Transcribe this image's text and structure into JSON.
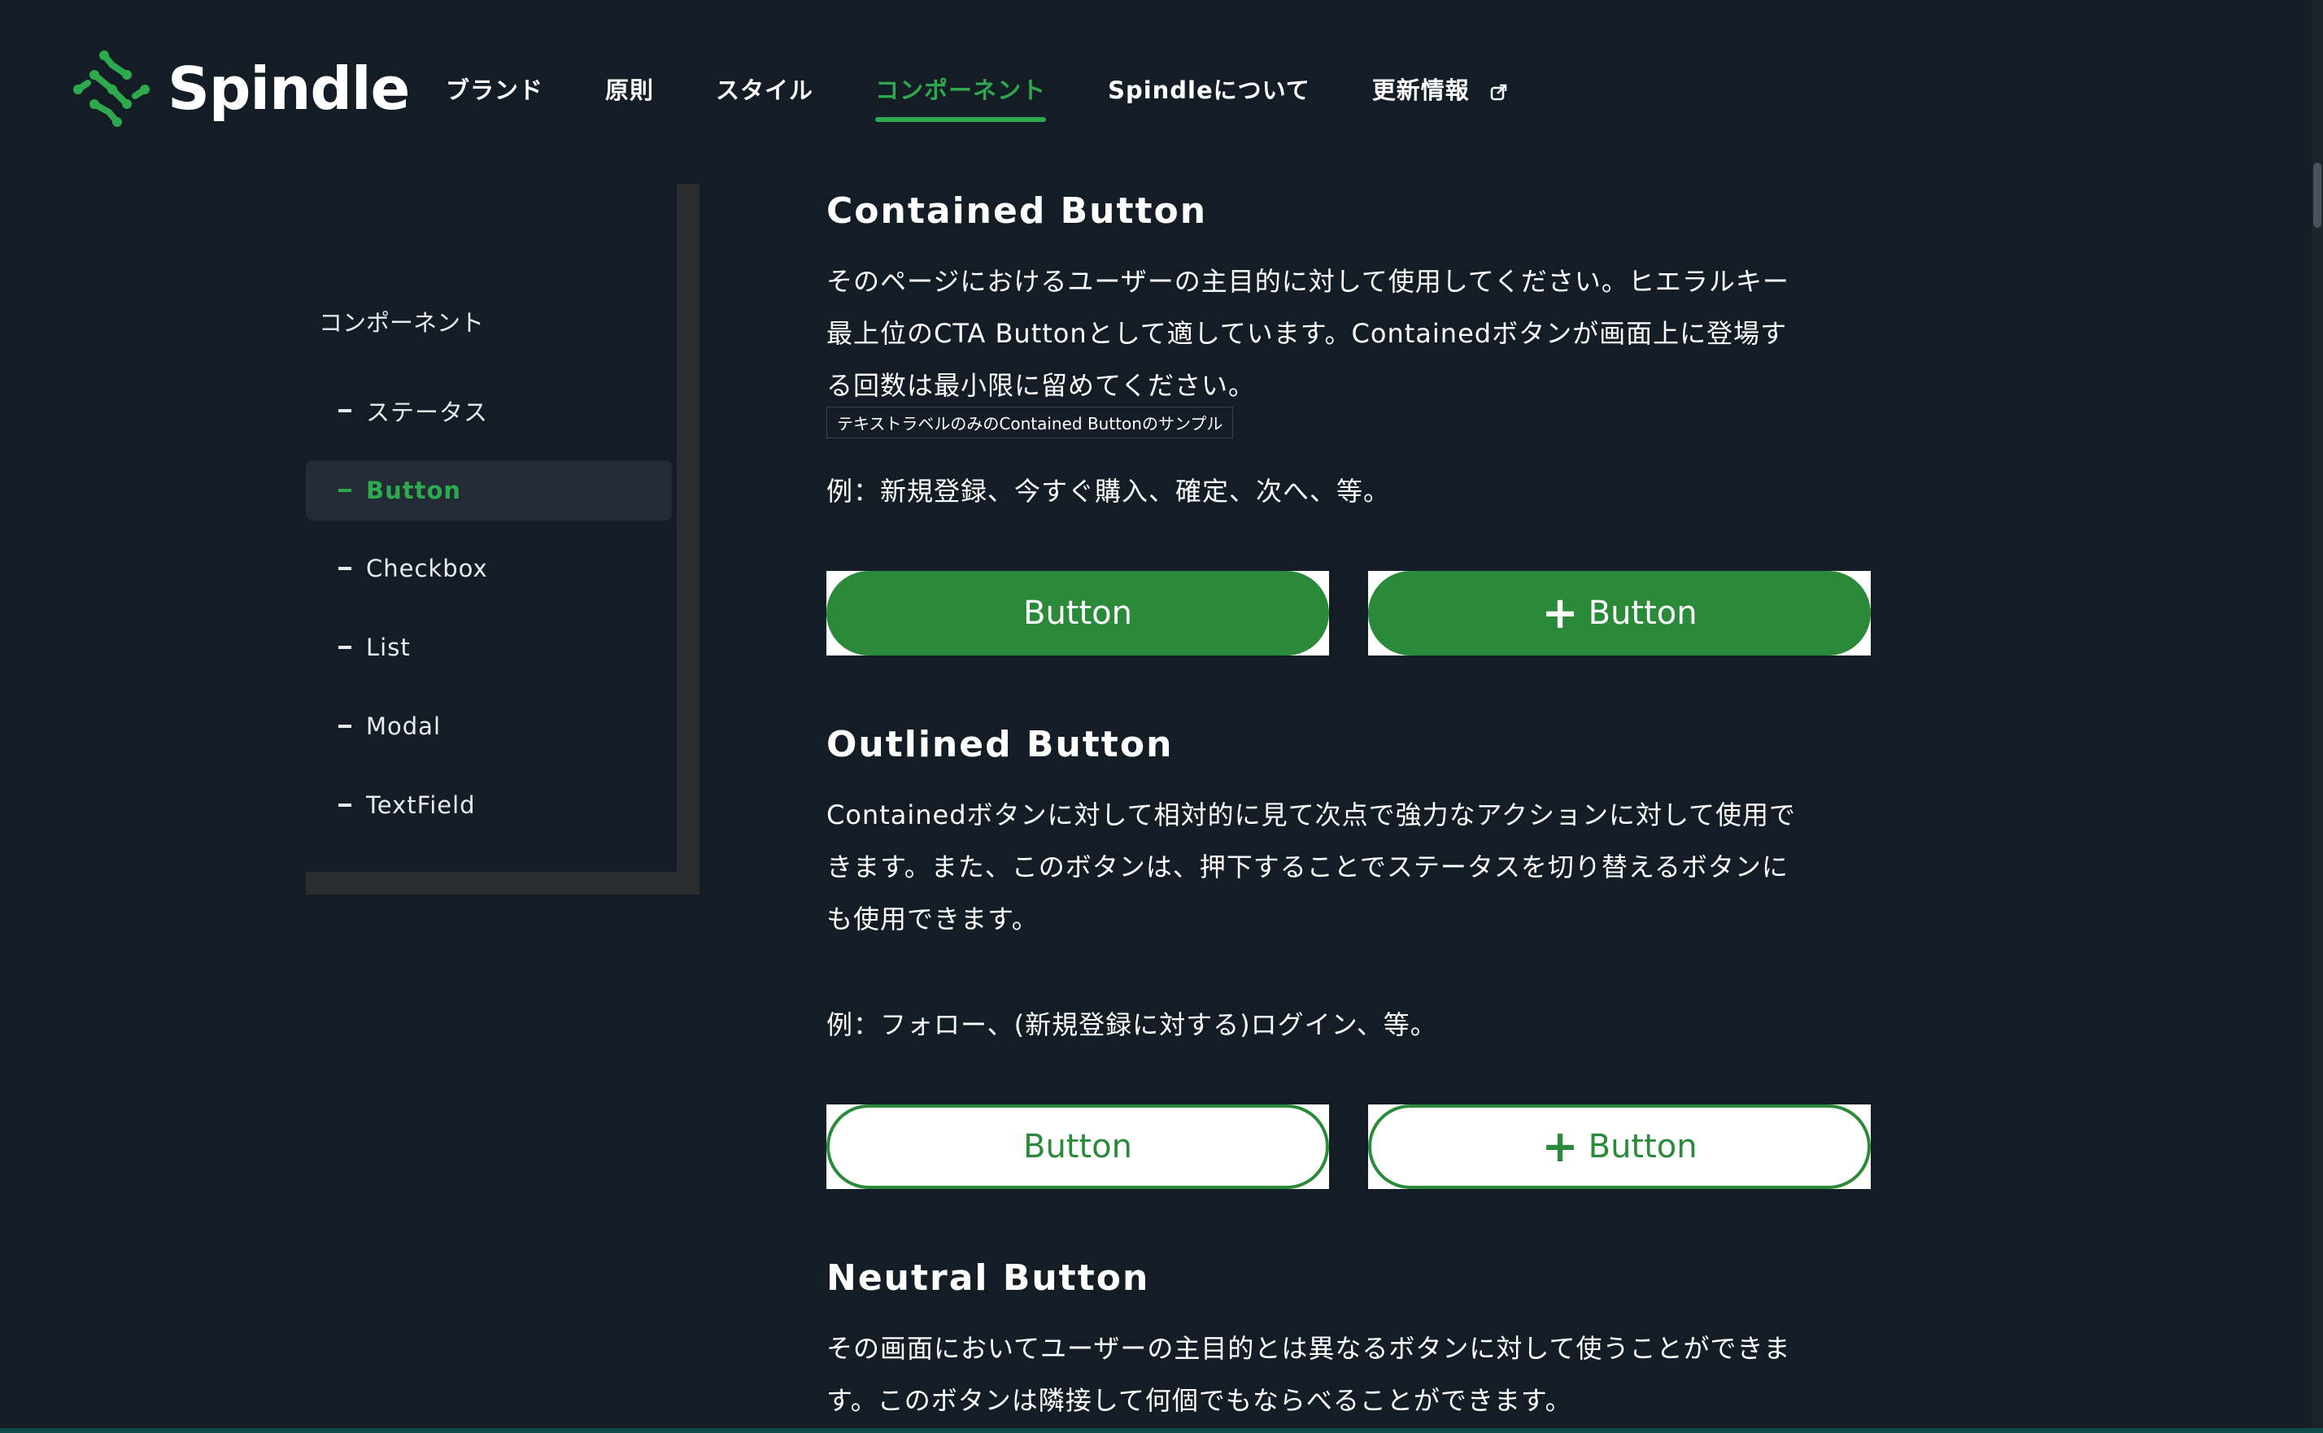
{
  "brand": {
    "name": "Spindle",
    "accent": "#2ea94d",
    "button_green": "#2b8a3a",
    "background": "#141d26"
  },
  "nav": {
    "items": [
      {
        "label": "ブランド"
      },
      {
        "label": "原則"
      },
      {
        "label": "スタイル"
      },
      {
        "label": "コンポーネント",
        "active": true
      },
      {
        "label": "Spindleについて"
      },
      {
        "label": "更新情報",
        "icon": "external-link-icon"
      }
    ]
  },
  "sidebar": {
    "heading": "コンポーネント",
    "items": [
      {
        "label": "ステータス"
      },
      {
        "label": "Button",
        "active": true
      },
      {
        "label": "Checkbox"
      },
      {
        "label": "List"
      },
      {
        "label": "Modal"
      },
      {
        "label": "TextField"
      }
    ]
  },
  "sections": {
    "contained": {
      "title": "Contained Button",
      "p1": "そのページにおけるユーザーの主目的に対して使用してください。ヒエラルキー",
      "p2": "最上位のCTA Buttonとして適しています。Containedボタンが画面上に登場す",
      "p3": "る回数は最小限に留めてください。",
      "tooltip": "テキストラベルのみのContained Buttonのサンプル",
      "example": "例：新規登録、今すぐ購入、確定、次へ、等。",
      "button_label": "Button",
      "button_icon_label": "Button"
    },
    "outlined": {
      "title": "Outlined Button",
      "p1": "Containedボタンに対して相対的に見て次点で強力なアクションに対して使用で",
      "p2": "きます。また、このボタンは、押下することでステータスを切り替えるボタンに",
      "p3": "も使用できます。",
      "example": "例：フォロー、(新規登録に対する)ログイン、等。",
      "button_label": "Button",
      "button_icon_label": "Button"
    },
    "neutral": {
      "title": "Neutral Button",
      "p1": "その画面においてユーザーの主目的とは異なるボタンに対して使うことができま",
      "p2": "す。このボタンは隣接して何個でもならべることができます。"
    }
  },
  "icons": {
    "plus": "+"
  }
}
